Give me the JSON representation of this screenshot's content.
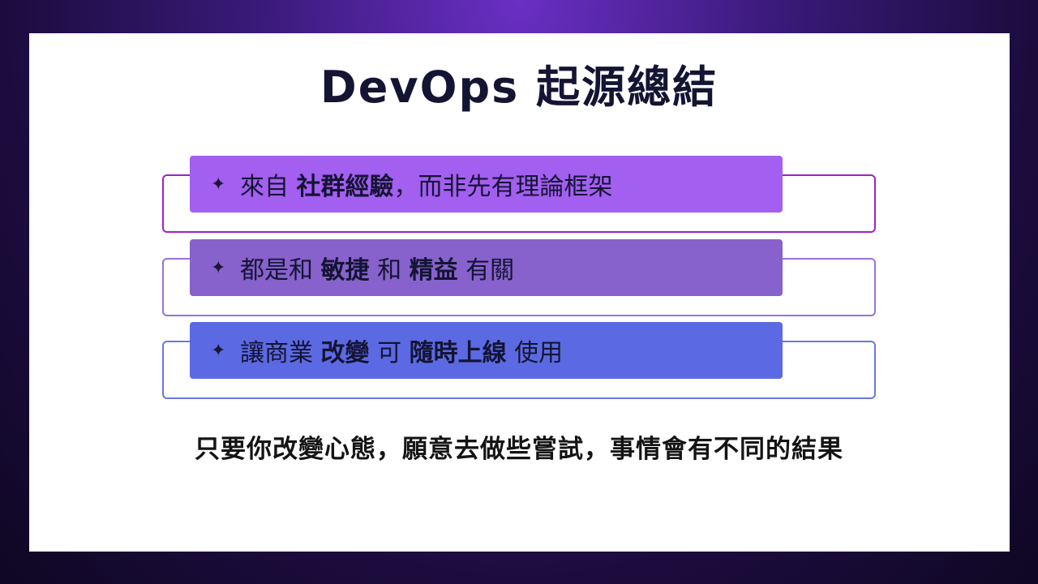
{
  "slide": {
    "title": "DevOps 起源總結",
    "items": [
      {
        "bullet": "✦",
        "segments": [
          {
            "text": "來自 ",
            "bold": false
          },
          {
            "text": "社群經驗",
            "bold": true
          },
          {
            "text": "，而非先有理論框架",
            "bold": false
          }
        ]
      },
      {
        "bullet": "✦",
        "segments": [
          {
            "text": "都是和 ",
            "bold": false
          },
          {
            "text": "敏捷",
            "bold": true
          },
          {
            "text": " 和 ",
            "bold": false
          },
          {
            "text": "精益",
            "bold": true
          },
          {
            "text": " 有關",
            "bold": false
          }
        ]
      },
      {
        "bullet": "✦",
        "segments": [
          {
            "text": "讓商業 ",
            "bold": false
          },
          {
            "text": "改變",
            "bold": true
          },
          {
            "text": " 可 ",
            "bold": false
          },
          {
            "text": "隨時上線",
            "bold": true
          },
          {
            "text": " 使用",
            "bold": false
          }
        ]
      }
    ],
    "footer": "只要你改變心態，願意去做些嘗試，事情會有不同的結果"
  },
  "colors": {
    "item1_bar": "#a35ff0",
    "item2_bar": "#8762cc",
    "item3_bar": "#5b6ae3",
    "title_text": "#141433"
  }
}
